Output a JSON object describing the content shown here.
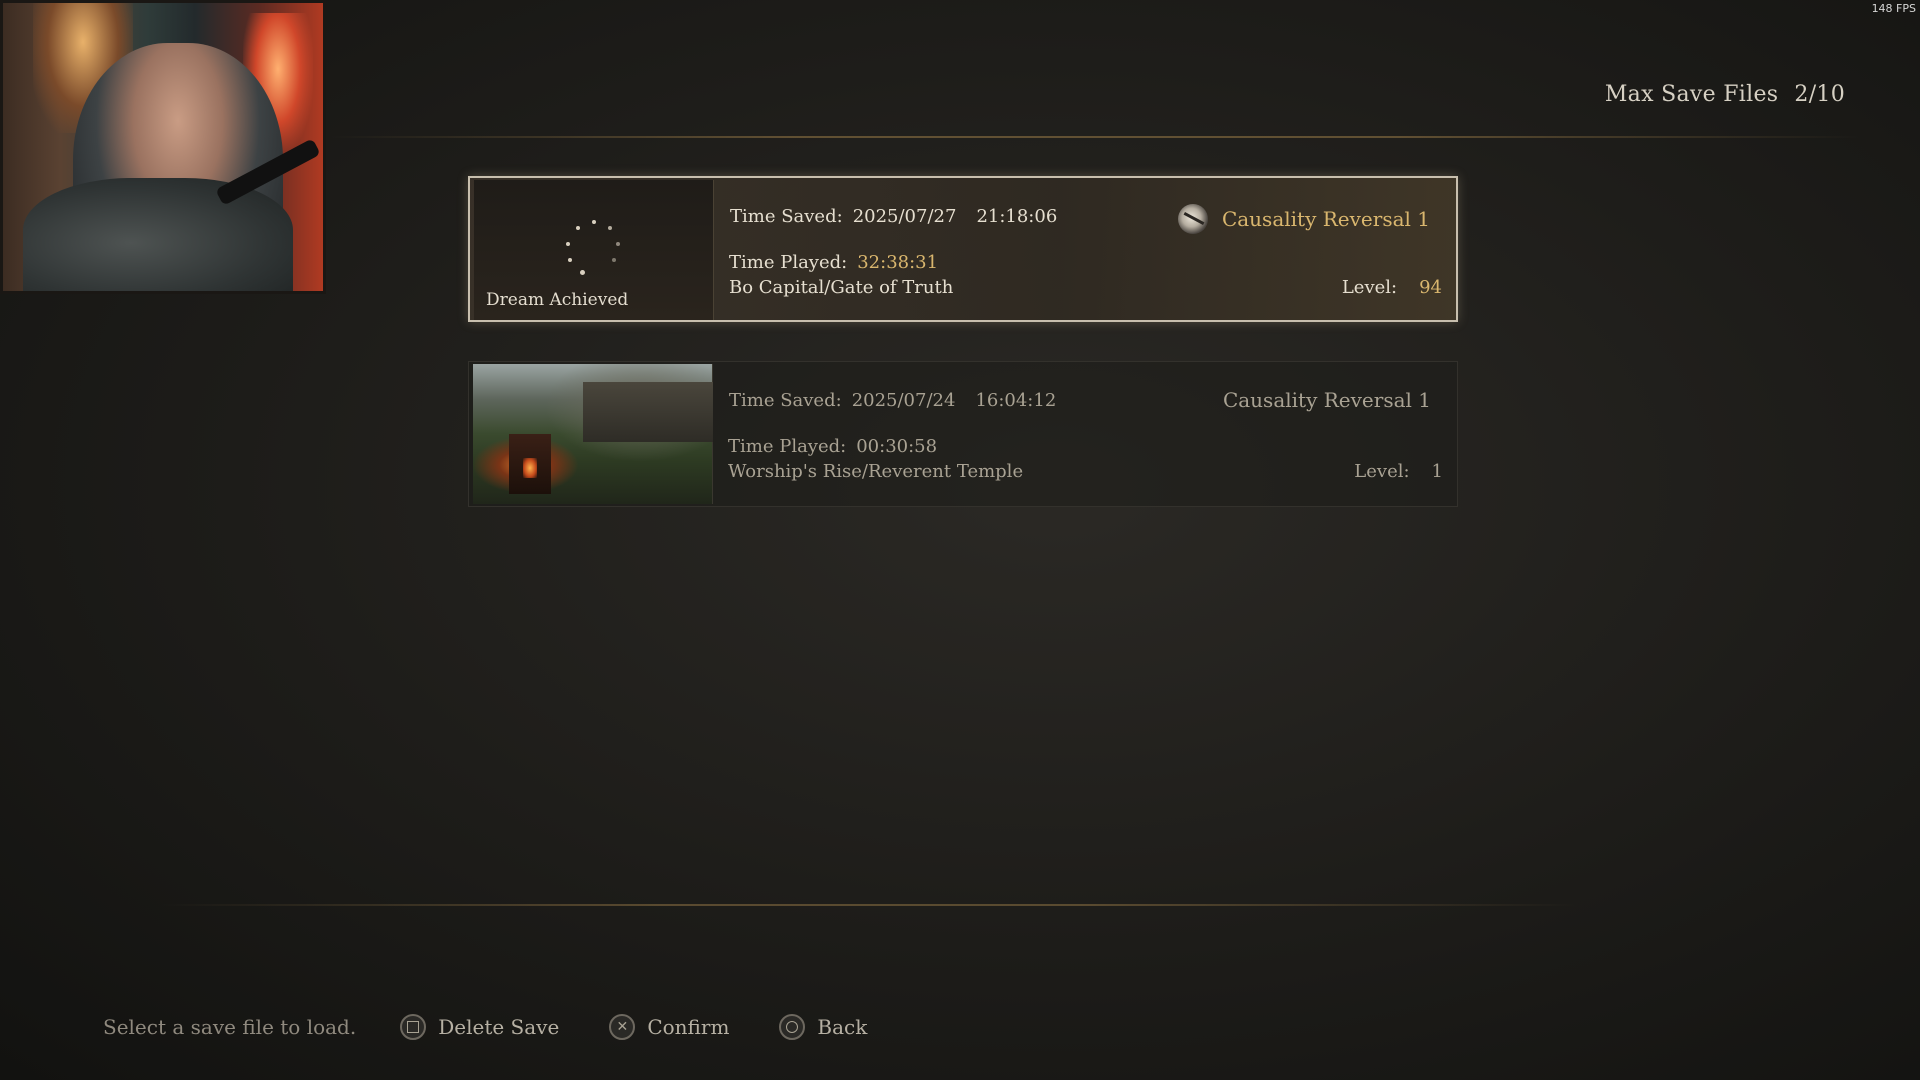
{
  "overlay": {
    "fps": "148 FPS"
  },
  "header": {
    "max_save_label": "Max Save Files",
    "max_save_count": "2/10"
  },
  "saves": [
    {
      "thumbnail_label": "Dream Achieved",
      "time_saved_label": "Time Saved:",
      "date": "2025/07/27",
      "time": "21:18:06",
      "time_played_label": "Time Played:",
      "time_played": "32:38:31",
      "location": "Bo Capital/Gate of Truth",
      "difficulty": "Causality Reversal 1",
      "level_label": "Level:",
      "level": "94",
      "selected": true
    },
    {
      "time_saved_label": "Time Saved:",
      "date": "2025/07/24",
      "time": "16:04:12",
      "time_played_label": "Time Played:",
      "time_played": "00:30:58",
      "location": "Worship's Rise/Reverent Temple",
      "difficulty": "Causality Reversal 1",
      "level_label": "Level:",
      "level": "1",
      "selected": false
    }
  ],
  "footer": {
    "hint": "Select a save file to load.",
    "delete_label": "Delete Save",
    "confirm_label": "Confirm",
    "back_label": "Back"
  },
  "colors": {
    "accent_gold": "#d9b66e",
    "text_light": "#e6dfd0",
    "text_dim": "#a9a293"
  }
}
